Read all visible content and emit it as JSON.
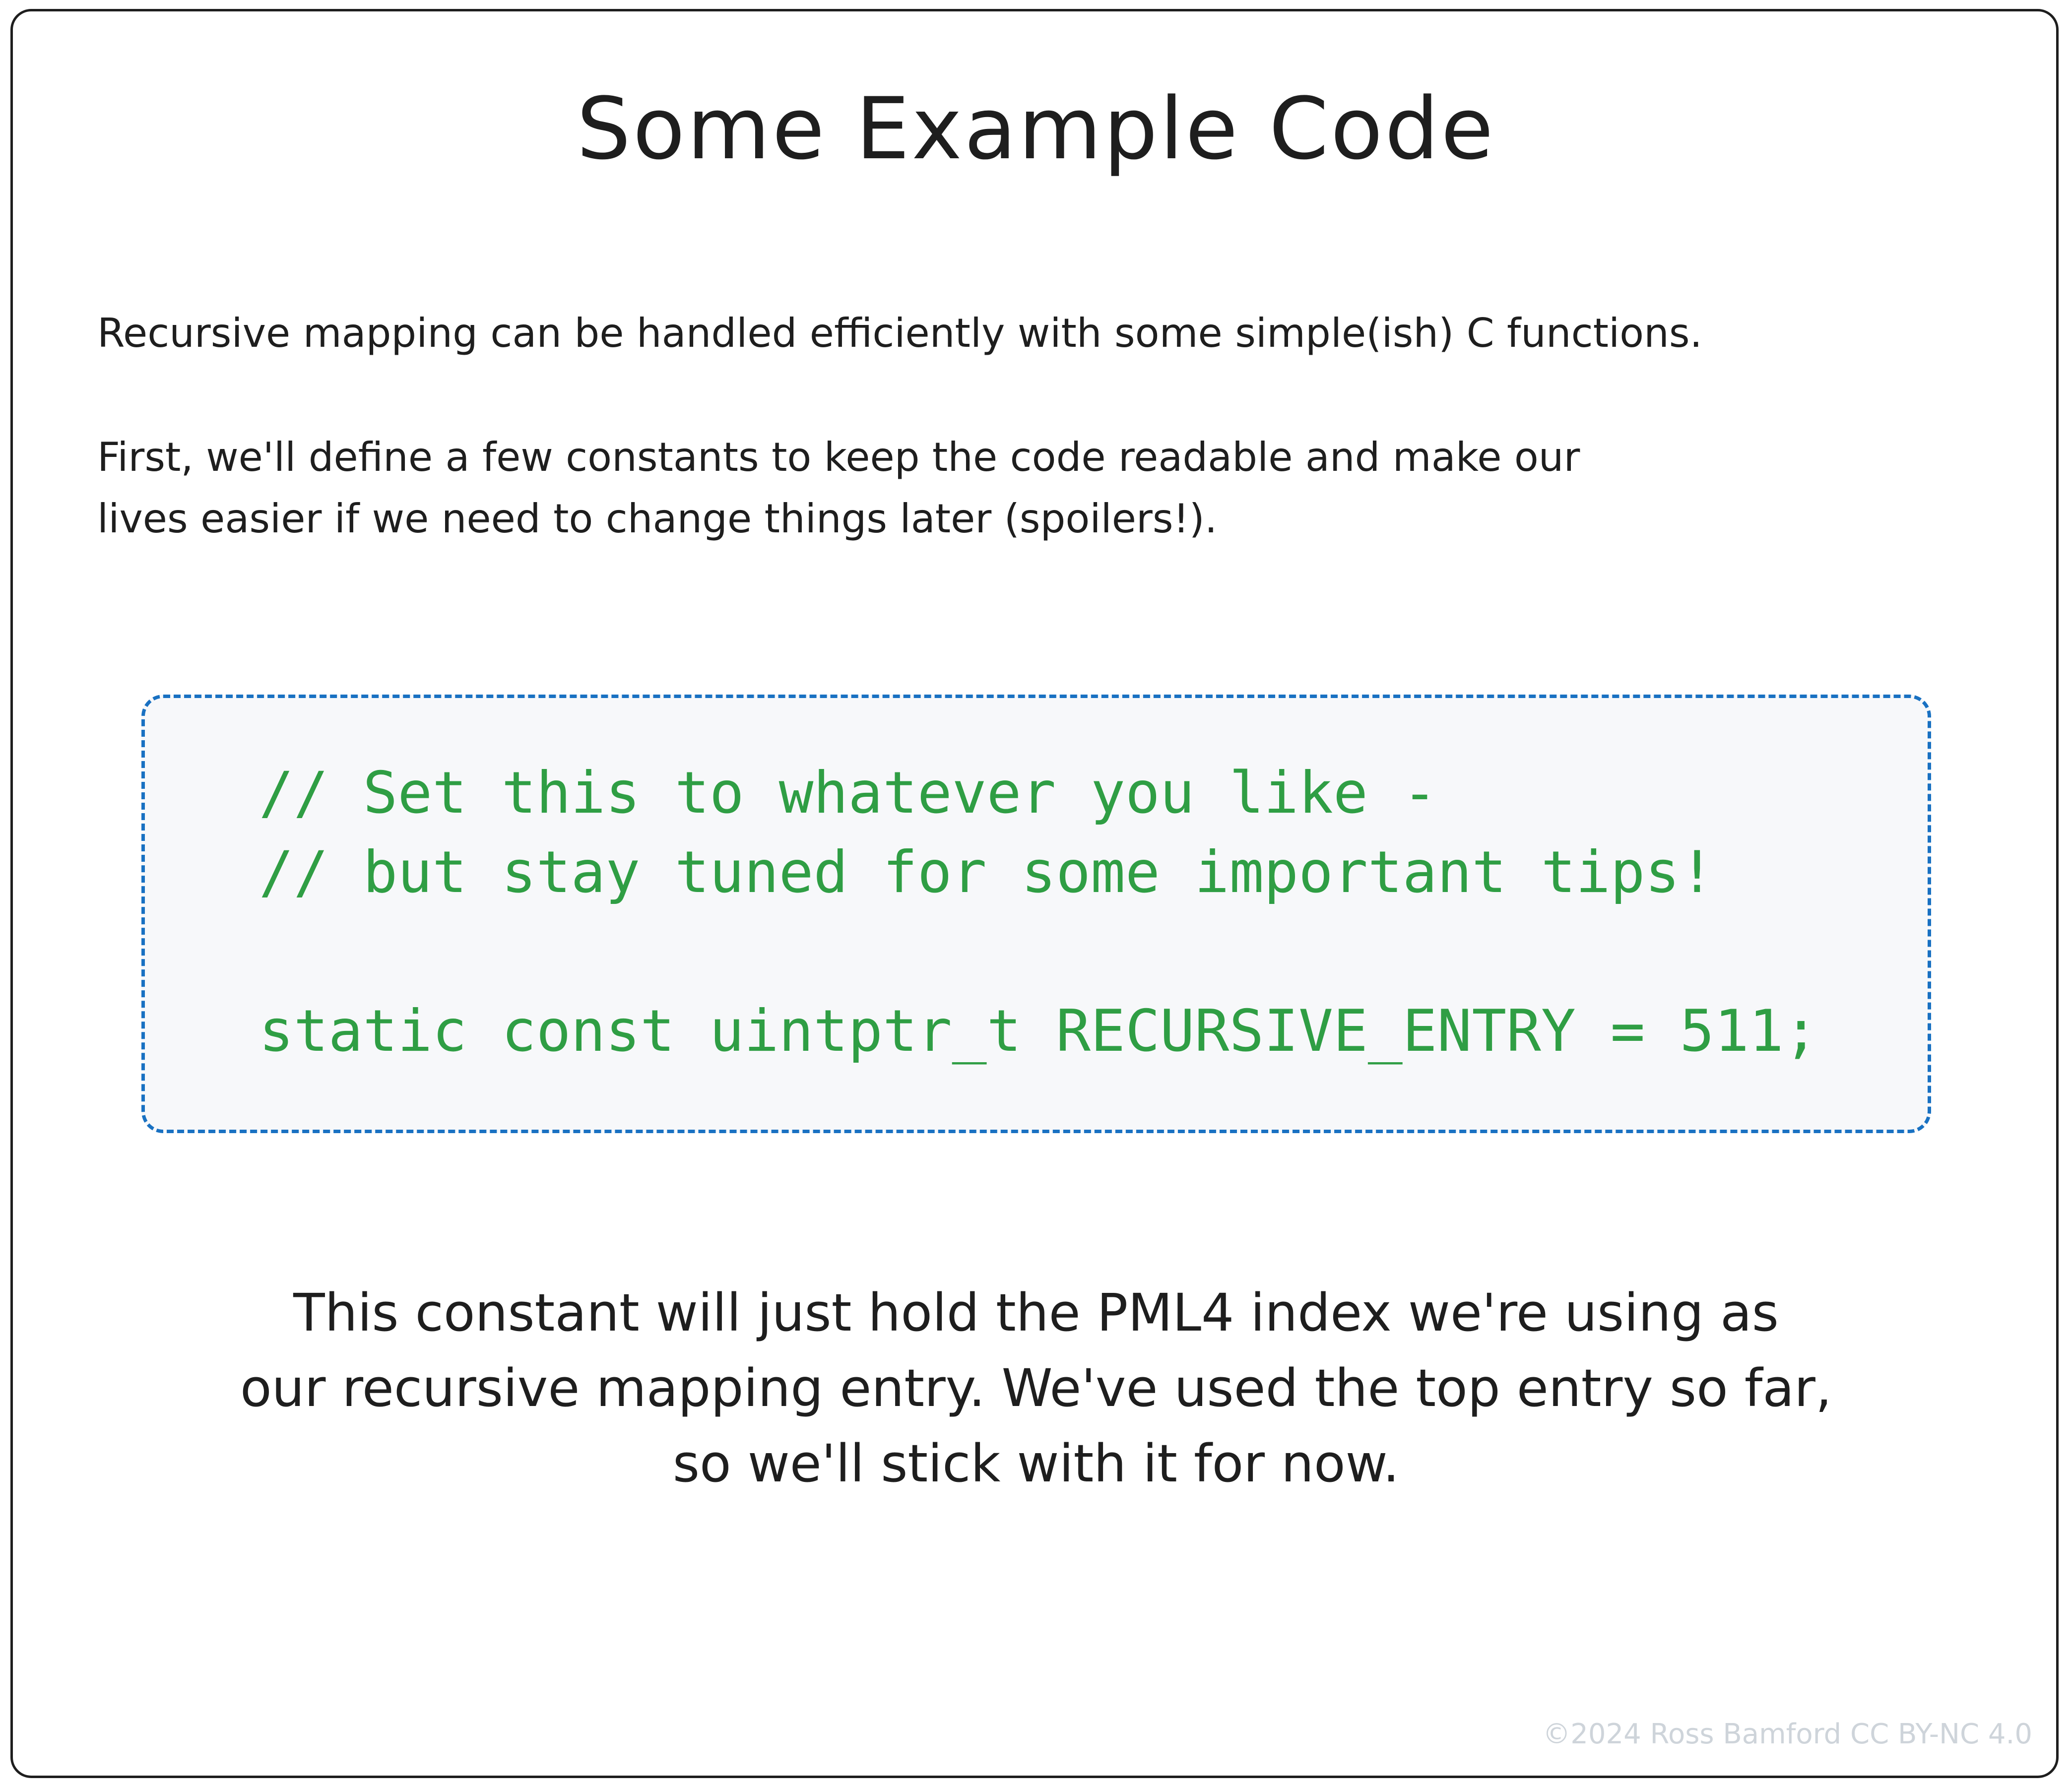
{
  "title": "Some Example Code",
  "intro": {
    "paragraph_1": "Recursive mapping can be handled efficiently with some simple(ish) C functions.",
    "paragraph_2_line_1": "First, we'll define a few constants to keep the code readable and make our",
    "paragraph_2_line_2": "lives easier if we need to change things later (spoilers!)."
  },
  "code": {
    "line_1": "// Set this to whatever you like -",
    "line_2": "// but stay tuned for some important tips!",
    "line_3": "static const uintptr_t RECURSIVE_ENTRY = 511;"
  },
  "outro": {
    "line_1": "This constant will just hold the PML4 index we're using as",
    "line_2": "our recursive mapping entry. We've used the top entry so far,",
    "line_3": "so we'll stick with it for now."
  },
  "copyright": "©2024 Ross Bamford CC BY-NC 4.0",
  "colors": {
    "text": "#1e1e1e",
    "code_text": "#2f9e44",
    "code_border": "#1971c2",
    "code_background": "#f7f8fa",
    "copyright_text": "#ced4da"
  }
}
